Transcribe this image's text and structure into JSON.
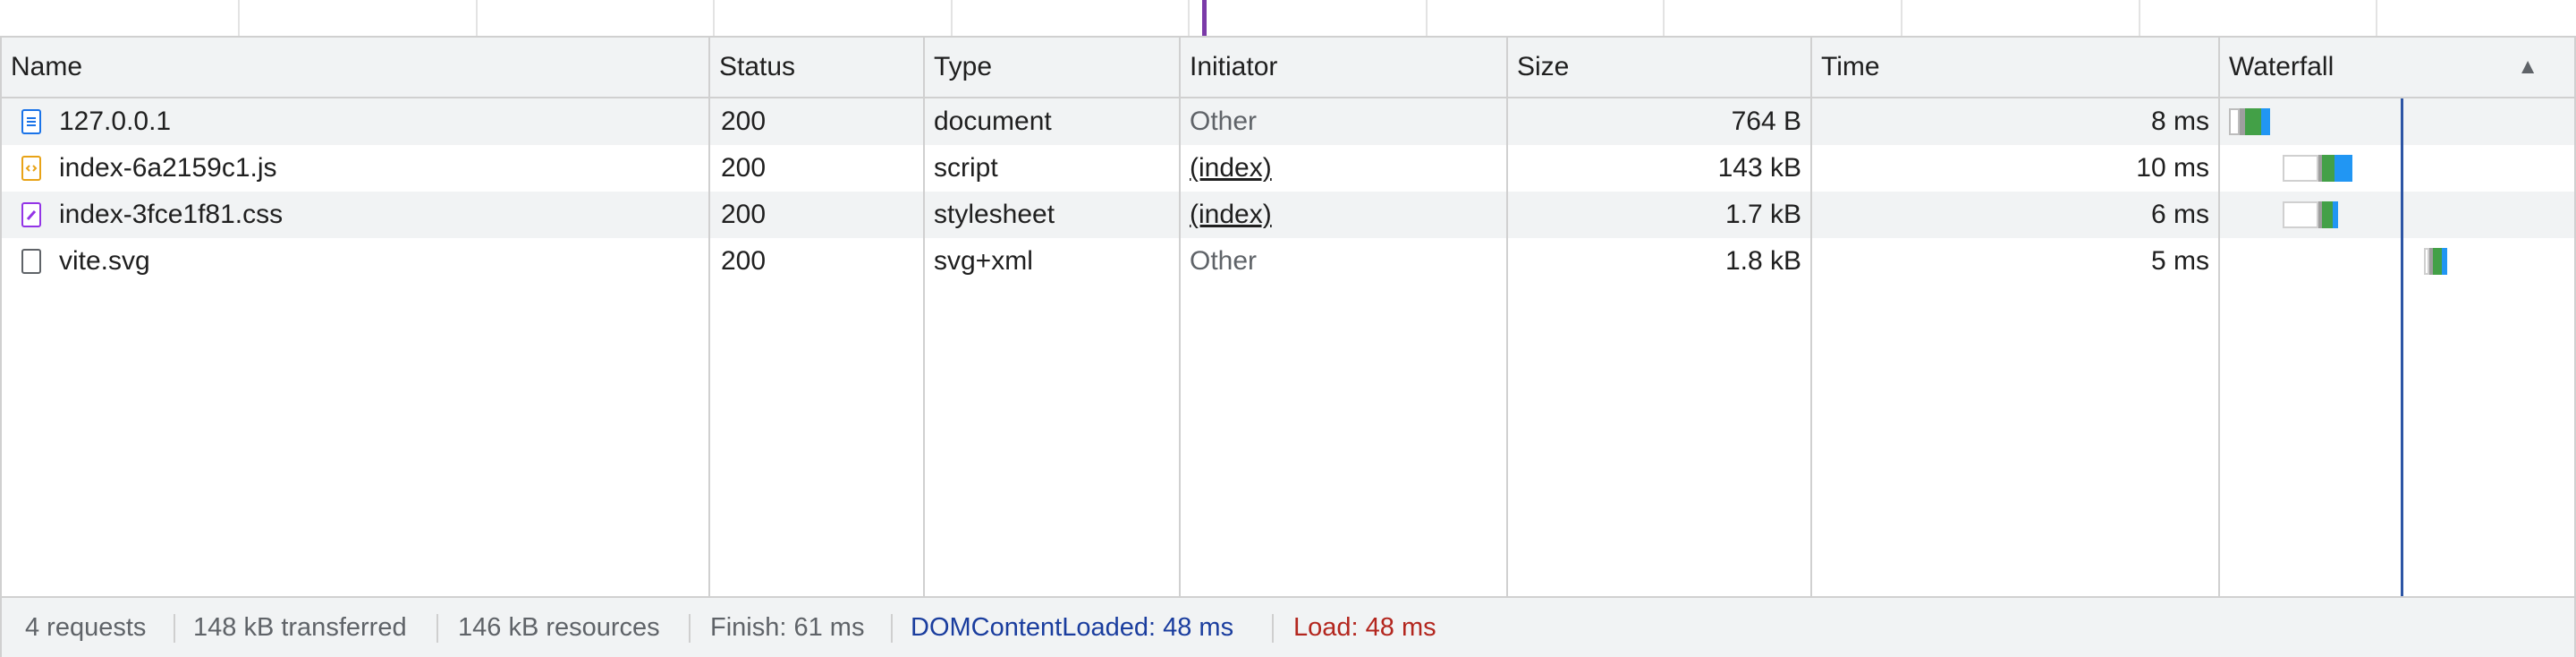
{
  "overview": {
    "marker_color": "#7b3aa8"
  },
  "columns": {
    "name": "Name",
    "status": "Status",
    "type": "Type",
    "initiator": "Initiator",
    "size": "Size",
    "time": "Time",
    "waterfall": "Waterfall",
    "sort_indicator": "▲"
  },
  "rows": [
    {
      "name": "127.0.0.1",
      "icon": "document-icon",
      "status": "200",
      "type": "document",
      "initiator": "Other",
      "initiator_link": false,
      "size": "764 B",
      "time": "8 ms"
    },
    {
      "name": "index-6a2159c1.js",
      "icon": "script-icon",
      "status": "200",
      "type": "script",
      "initiator": "(index)",
      "initiator_link": true,
      "size": "143 kB",
      "time": "10 ms"
    },
    {
      "name": "index-3fce1f81.css",
      "icon": "stylesheet-icon",
      "status": "200",
      "type": "stylesheet",
      "initiator": "(index)",
      "initiator_link": true,
      "size": "1.7 kB",
      "time": "6 ms"
    },
    {
      "name": "vite.svg",
      "icon": "file-icon",
      "status": "200",
      "type": "svg+xml",
      "initiator": "Other",
      "initiator_link": false,
      "size": "1.8 kB",
      "time": "5 ms"
    }
  ],
  "status_bar": {
    "requests": "4 requests",
    "transferred": "148 kB transferred",
    "resources": "146 kB resources",
    "finish": "Finish: 61 ms",
    "dom_content_loaded": "DOMContentLoaded: 48 ms",
    "load": "Load: 48 ms"
  },
  "colors": {
    "dom_content_loaded": "#1a3d9e",
    "load": "#b3261e",
    "waiting": "#43a047",
    "download": "#2196f3",
    "queue": "#d9d9d9",
    "dcl_line": "#2d55a5"
  }
}
